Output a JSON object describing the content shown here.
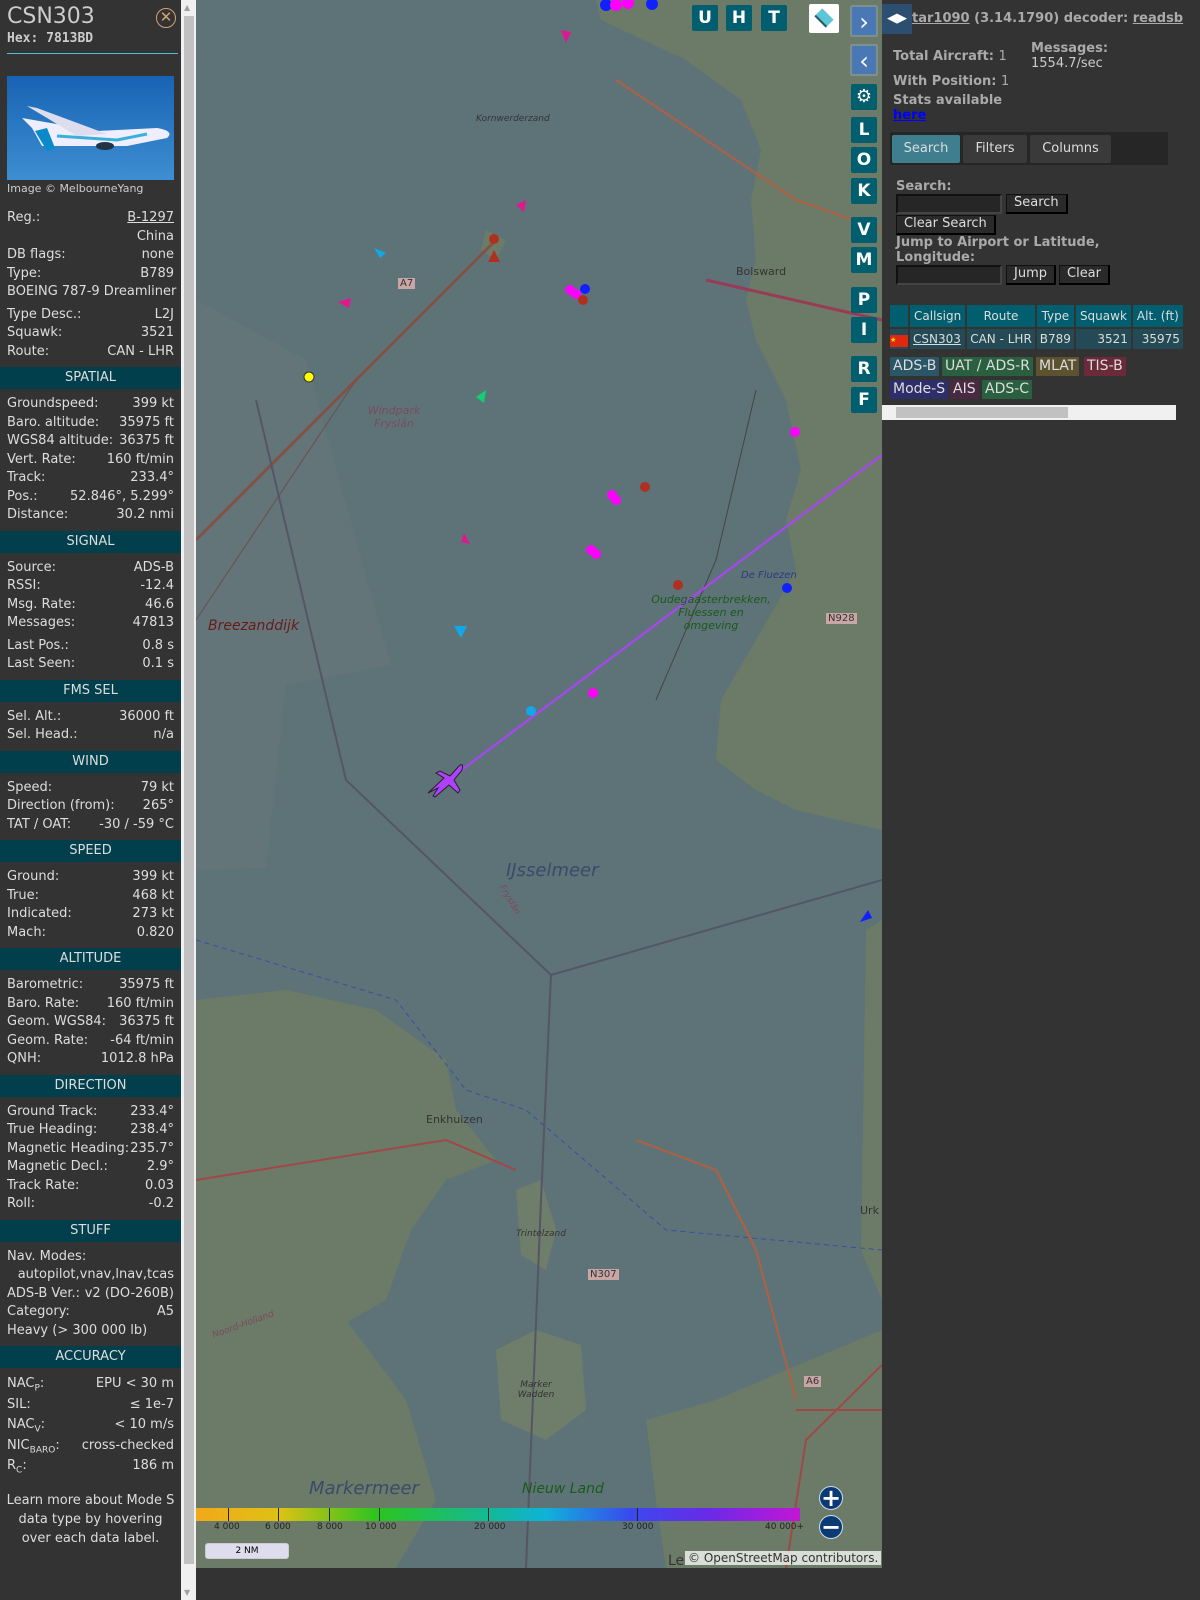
{
  "sidebar": {
    "callsign": "CSN303",
    "hex": "Hex: 7813BD",
    "photo_credit": "Image © MelbourneYang",
    "general": [
      {
        "label": "Reg.:",
        "value": "B-1297",
        "link": true
      },
      {
        "label": "",
        "value": "China"
      },
      {
        "label": "DB flags:",
        "value": "none"
      },
      {
        "label": "Type:",
        "value": "B789"
      },
      {
        "full": "BOEING 787-9 Dreamliner"
      },
      {
        "label": "Type Desc.:",
        "value": "L2J",
        "gap": true
      },
      {
        "label": "Squawk:",
        "value": "3521"
      },
      {
        "label": "Route:",
        "value": "CAN - LHR"
      }
    ],
    "sections": [
      {
        "title": "SPATIAL",
        "rows": [
          [
            "Groundspeed:",
            "399 kt"
          ],
          [
            "Baro. altitude:",
            "35975 ft"
          ],
          [
            "WGS84 altitude:",
            "36375 ft"
          ],
          [
            "Vert. Rate:",
            "160 ft/min"
          ],
          [
            "Track:",
            "233.4°"
          ],
          [
            "Pos.:",
            "52.846°, 5.299°"
          ],
          [
            "Distance:",
            "30.2 nmi"
          ]
        ]
      },
      {
        "title": "SIGNAL",
        "rows": [
          [
            "Source:",
            "ADS-B"
          ],
          [
            "RSSI:",
            "-12.4"
          ],
          [
            "Msg. Rate:",
            "46.6"
          ],
          [
            "Messages:",
            "47813"
          ],
          [
            "Last Pos.:",
            "0.8 s"
          ],
          [
            "Last Seen:",
            "0.1 s"
          ]
        ]
      },
      {
        "title": "FMS SEL",
        "rows": [
          [
            "Sel. Alt.:",
            "36000 ft"
          ],
          [
            "Sel. Head.:",
            "n/a"
          ]
        ]
      },
      {
        "title": "WIND",
        "rows": [
          [
            "Speed:",
            "79 kt"
          ],
          [
            "Direction (from):",
            "265°"
          ],
          [
            "TAT / OAT:",
            "-30 / -59 °C"
          ]
        ]
      },
      {
        "title": "SPEED",
        "rows": [
          [
            "Ground:",
            "399 kt"
          ],
          [
            "True:",
            "468 kt"
          ],
          [
            "Indicated:",
            "273 kt"
          ],
          [
            "Mach:",
            "0.820"
          ]
        ]
      },
      {
        "title": "ALTITUDE",
        "rows": [
          [
            "Barometric:",
            "35975 ft"
          ],
          [
            "Baro. Rate:",
            "160 ft/min"
          ],
          [
            "Geom. WGS84:",
            "36375 ft"
          ],
          [
            "Geom. Rate:",
            "-64 ft/min"
          ],
          [
            "QNH:",
            "1012.8 hPa"
          ]
        ]
      },
      {
        "title": "DIRECTION",
        "rows": [
          [
            "Ground Track:",
            "233.4°"
          ],
          [
            "True Heading:",
            "238.4°"
          ],
          [
            "Magnetic Heading:",
            "235.7°"
          ],
          [
            "Magnetic Decl.:",
            "2.9°"
          ],
          [
            "Track Rate:",
            "0.03"
          ],
          [
            "Roll:",
            "-0.2"
          ]
        ]
      }
    ],
    "stuff": {
      "title": "STUFF",
      "nav_label": "Nav. Modes:",
      "nav_value": "autopilot,vnav,lnav,tcas",
      "adsb_label": "ADS-B Ver.:",
      "adsb_value": "v2 (DO-260B)",
      "cat_label": "Category:",
      "cat_value": "A5",
      "cat_desc": "Heavy (> 300 000 lb)"
    },
    "accuracy": {
      "title": "ACCURACY",
      "rows": [
        [
          "NAC",
          "P",
          ":",
          "EPU < 30 m"
        ],
        [
          "SIL",
          "",
          ":",
          "≤ 1e-7"
        ],
        [
          "NAC",
          "V",
          ":",
          "< 10 m/s"
        ],
        [
          "NIC",
          "BARO",
          ":",
          "cross-checked"
        ],
        [
          "R",
          "C",
          ":",
          "186 m"
        ]
      ]
    },
    "note": "Learn more about Mode S data type by hovering over each data label."
  },
  "map": {
    "labels": [
      "Kornwerderzand",
      "Bolsward",
      "Windpark Fryslân",
      "Breezanddijk",
      "Oudegaasterbrekken, Fluessen en omgeving",
      "De Fluezen",
      "IJsselmeer",
      "Enkhuizen",
      "Trintelzand",
      "Marker Wadden",
      "Markermeer",
      "Nieuw Land",
      "Noord-Holland",
      "Fryslân",
      "Urk",
      "N928",
      "N307",
      "A7",
      "A6",
      "Le"
    ],
    "top_buttons": [
      "U",
      "H",
      "T"
    ],
    "side_buttons": [
      "L",
      "O",
      "K",
      "V",
      "M",
      "P",
      "I",
      "R",
      "F"
    ],
    "scale": "2 NM",
    "attribution": "© OpenStreetMap contributors.",
    "legend_ticks": [
      "4 000",
      "6 000",
      "8 000",
      "10 000",
      "20 000",
      "30 000",
      "40 000+"
    ]
  },
  "panel": {
    "app": "tar1090",
    "version": "(3.14.1790)",
    "decoder_label": "decoder:",
    "decoder": "readsb",
    "total_label": "Total Aircraft:",
    "total": "1",
    "pos_label": "With Position:",
    "pos": "1",
    "msgs_label": "Messages:",
    "msgs": "1554.7/sec",
    "stats": "Stats available",
    "here": "here",
    "tabs": [
      "Search",
      "Filters",
      "Columns"
    ],
    "search_label": "Search:",
    "search_btn": "Search",
    "clear_search": "Clear Search",
    "jump_label": "Jump to Airport or Latitude, Longitude:",
    "jump_btn": "Jump",
    "clear_btn": "Clear",
    "columns": [
      "Callsign",
      "Route",
      "Type",
      "Squawk",
      "Alt. (ft)"
    ],
    "row": {
      "callsign": "CSN303",
      "route": "CAN - LHR",
      "type": "B789",
      "squawk": "3521",
      "alt": "35975"
    },
    "sources": [
      {
        "label": "ADS-B",
        "color": "#2b5666"
      },
      {
        "label": "UAT / ADS-R",
        "color": "#2a6040"
      },
      {
        "label": "MLAT",
        "color": "#5c5230"
      },
      {
        "label": "TIS-B",
        "color": "#6a2a3a"
      },
      {
        "label": "Mode-S",
        "color": "#2e2e6a"
      },
      {
        "label": "AIS",
        "color": "#4a2a42"
      },
      {
        "label": "ADS-C",
        "color": "#2a6040"
      }
    ]
  }
}
